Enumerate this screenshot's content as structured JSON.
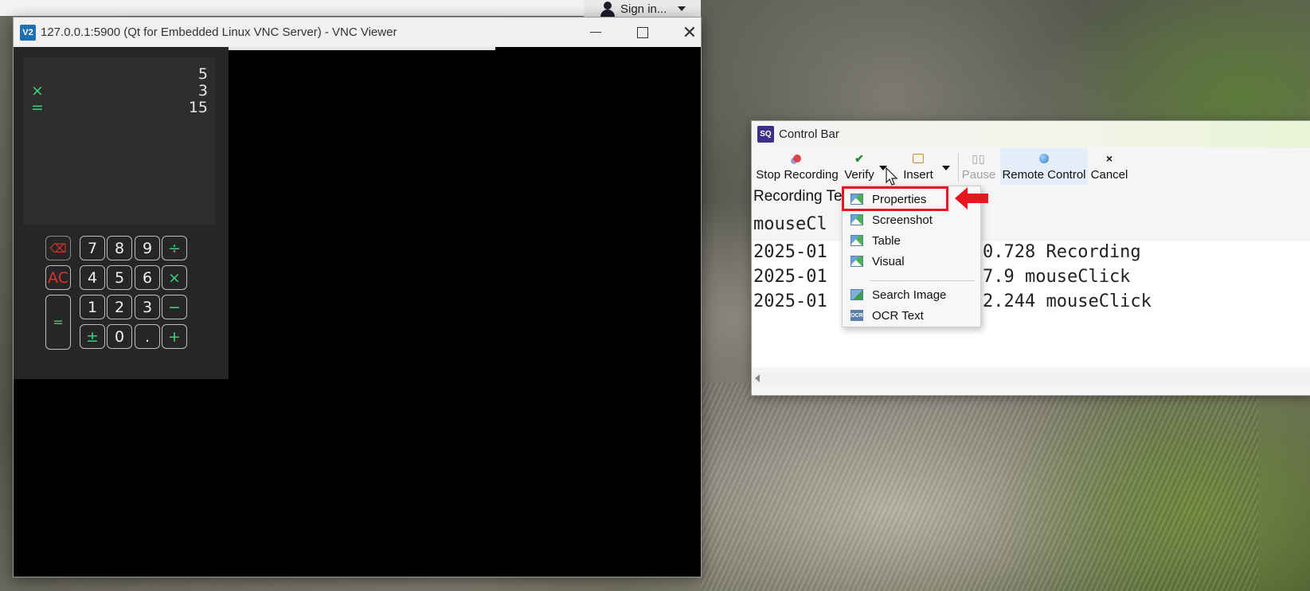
{
  "background_window": {
    "signin_label": "Sign in..."
  },
  "vnc": {
    "title": "127.0.0.1:5900 (Qt for Embedded Linux VNC Server) - VNC Viewer",
    "logo": "V2",
    "calculator": {
      "display": [
        {
          "op": "",
          "value": "5"
        },
        {
          "op": "×",
          "value": "3"
        },
        {
          "op": "=",
          "value": "15"
        }
      ],
      "keys": {
        "backspace": "⌫",
        "k7": "7",
        "k8": "8",
        "k9": "9",
        "div": "÷",
        "ac": "AC",
        "k4": "4",
        "k5": "5",
        "k6": "6",
        "mul": "×",
        "k1": "1",
        "k2": "2",
        "k3": "3",
        "minus": "−",
        "equals": "=",
        "plusminus": "±",
        "k0": "0",
        "dot": ".",
        "plus": "+"
      }
    }
  },
  "control_bar": {
    "title": "Control Bar",
    "logo": "SQ",
    "toolbar": {
      "stop_recording": "Stop Recording",
      "verify": "Verify",
      "insert": "Insert",
      "pause": "Pause",
      "remote_control": "Remote Control",
      "cancel": "Cancel"
    },
    "recording_label": "Recording Te",
    "current_command": "mouseCl",
    "log": [
      {
        "left": "2025-01",
        "right": "0.728 Recording"
      },
      {
        "left": "2025-01",
        "right": "7.9 mouseClick"
      },
      {
        "left": "2025-01",
        "right": "2.244 mouseClick"
      }
    ]
  },
  "verify_menu": {
    "items": [
      "Properties",
      "Screenshot",
      "Table",
      "Visual"
    ],
    "items2": [
      "Search Image",
      "OCR Text"
    ],
    "ocr_icon_text": "OCR"
  },
  "colors": {
    "accent_highlight": "#e8141e",
    "calc_green": "#3ecf7a",
    "calc_red": "#e0322c"
  },
  "icons": {
    "verify": "check-icon",
    "stop": "record-icon",
    "insert": "insert-icon",
    "pause": "pause-icon",
    "remote": "globe-icon",
    "cancel": "close-icon"
  }
}
